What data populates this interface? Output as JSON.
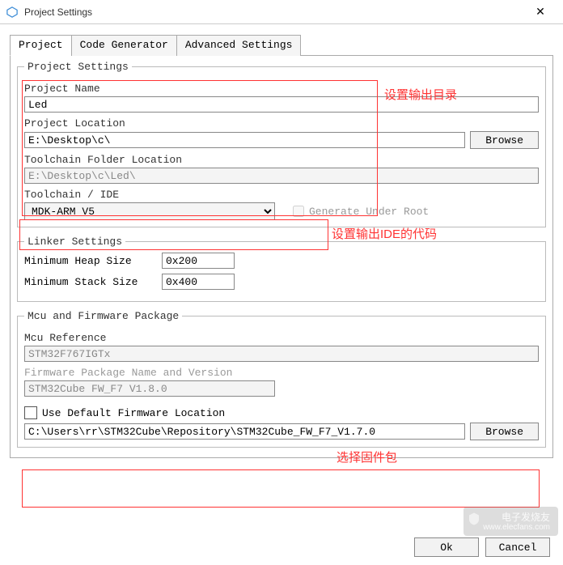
{
  "window": {
    "title": "Project Settings"
  },
  "tabs": {
    "t0": "Project",
    "t1": "Code Generator",
    "t2": "Advanced Settings"
  },
  "project_settings": {
    "legend": "Project Settings",
    "name_label": "Project Name",
    "name_value": "Led",
    "location_label": "Project Location",
    "location_value": "E:\\Desktop\\c\\",
    "browse_btn": "Browse",
    "folder_label": "Toolchain Folder Location",
    "folder_value": "E:\\Desktop\\c\\Led\\",
    "ide_label": "Toolchain / IDE",
    "ide_value": "MDK-ARM V5",
    "gen_root_label": "Generate Under Root"
  },
  "linker": {
    "legend": "Linker Settings",
    "heap_label": "Minimum Heap Size",
    "heap_value": "0x200",
    "stack_label": "Minimum Stack Size",
    "stack_value": "0x400"
  },
  "mcu": {
    "legend": "Mcu and Firmware Package",
    "ref_label": "Mcu Reference",
    "ref_value": "STM32F767IGTx",
    "fw_label": "Firmware Package Name and Version",
    "fw_value": "STM32Cube FW_F7 V1.8.0",
    "default_loc_label": "Use Default Firmware Location",
    "path_value": "C:\\Users\\rr\\STM32Cube\\Repository\\STM32Cube_FW_F7_V1.7.0",
    "browse_btn": "Browse"
  },
  "footer": {
    "ok": "Ok",
    "cancel": "Cancel"
  },
  "annotations": {
    "a1": "设置输出目录",
    "a2": "设置输出IDE的代码",
    "a3": "选择固件包"
  },
  "watermark": {
    "line1": "电子发烧友",
    "line2": "www.elecfans.com"
  }
}
